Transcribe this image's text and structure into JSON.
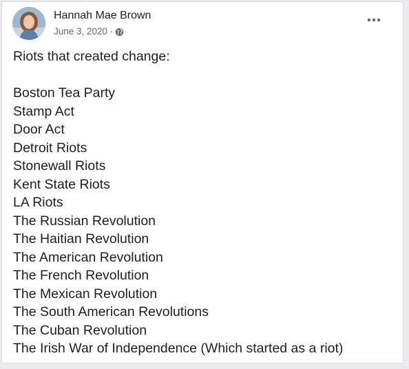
{
  "post": {
    "author": "Hannah Mae Brown",
    "date": "June 3, 2020",
    "separator": "·",
    "privacy_icon": "globe-icon",
    "more_icon": "more-horizontal-icon",
    "intro": "Riots that created change:",
    "items": [
      "Boston Tea Party",
      "Stamp Act",
      "Door Act",
      "Detroit Riots",
      "Stonewall Riots",
      "Kent State Riots",
      "LA Riots",
      "The Russian Revolution",
      "The Haitian Revolution",
      "The American Revolution",
      "The French Revolution",
      "The Mexican Revolution",
      "The South American Revolutions",
      "The Cuban Revolution",
      "The Irish War of Independence (Which started as a riot)"
    ]
  },
  "colors": {
    "text": "#1c1e21",
    "secondary_text": "#65676b",
    "card_background": "#ffffff",
    "page_background": "#e9ebee"
  }
}
